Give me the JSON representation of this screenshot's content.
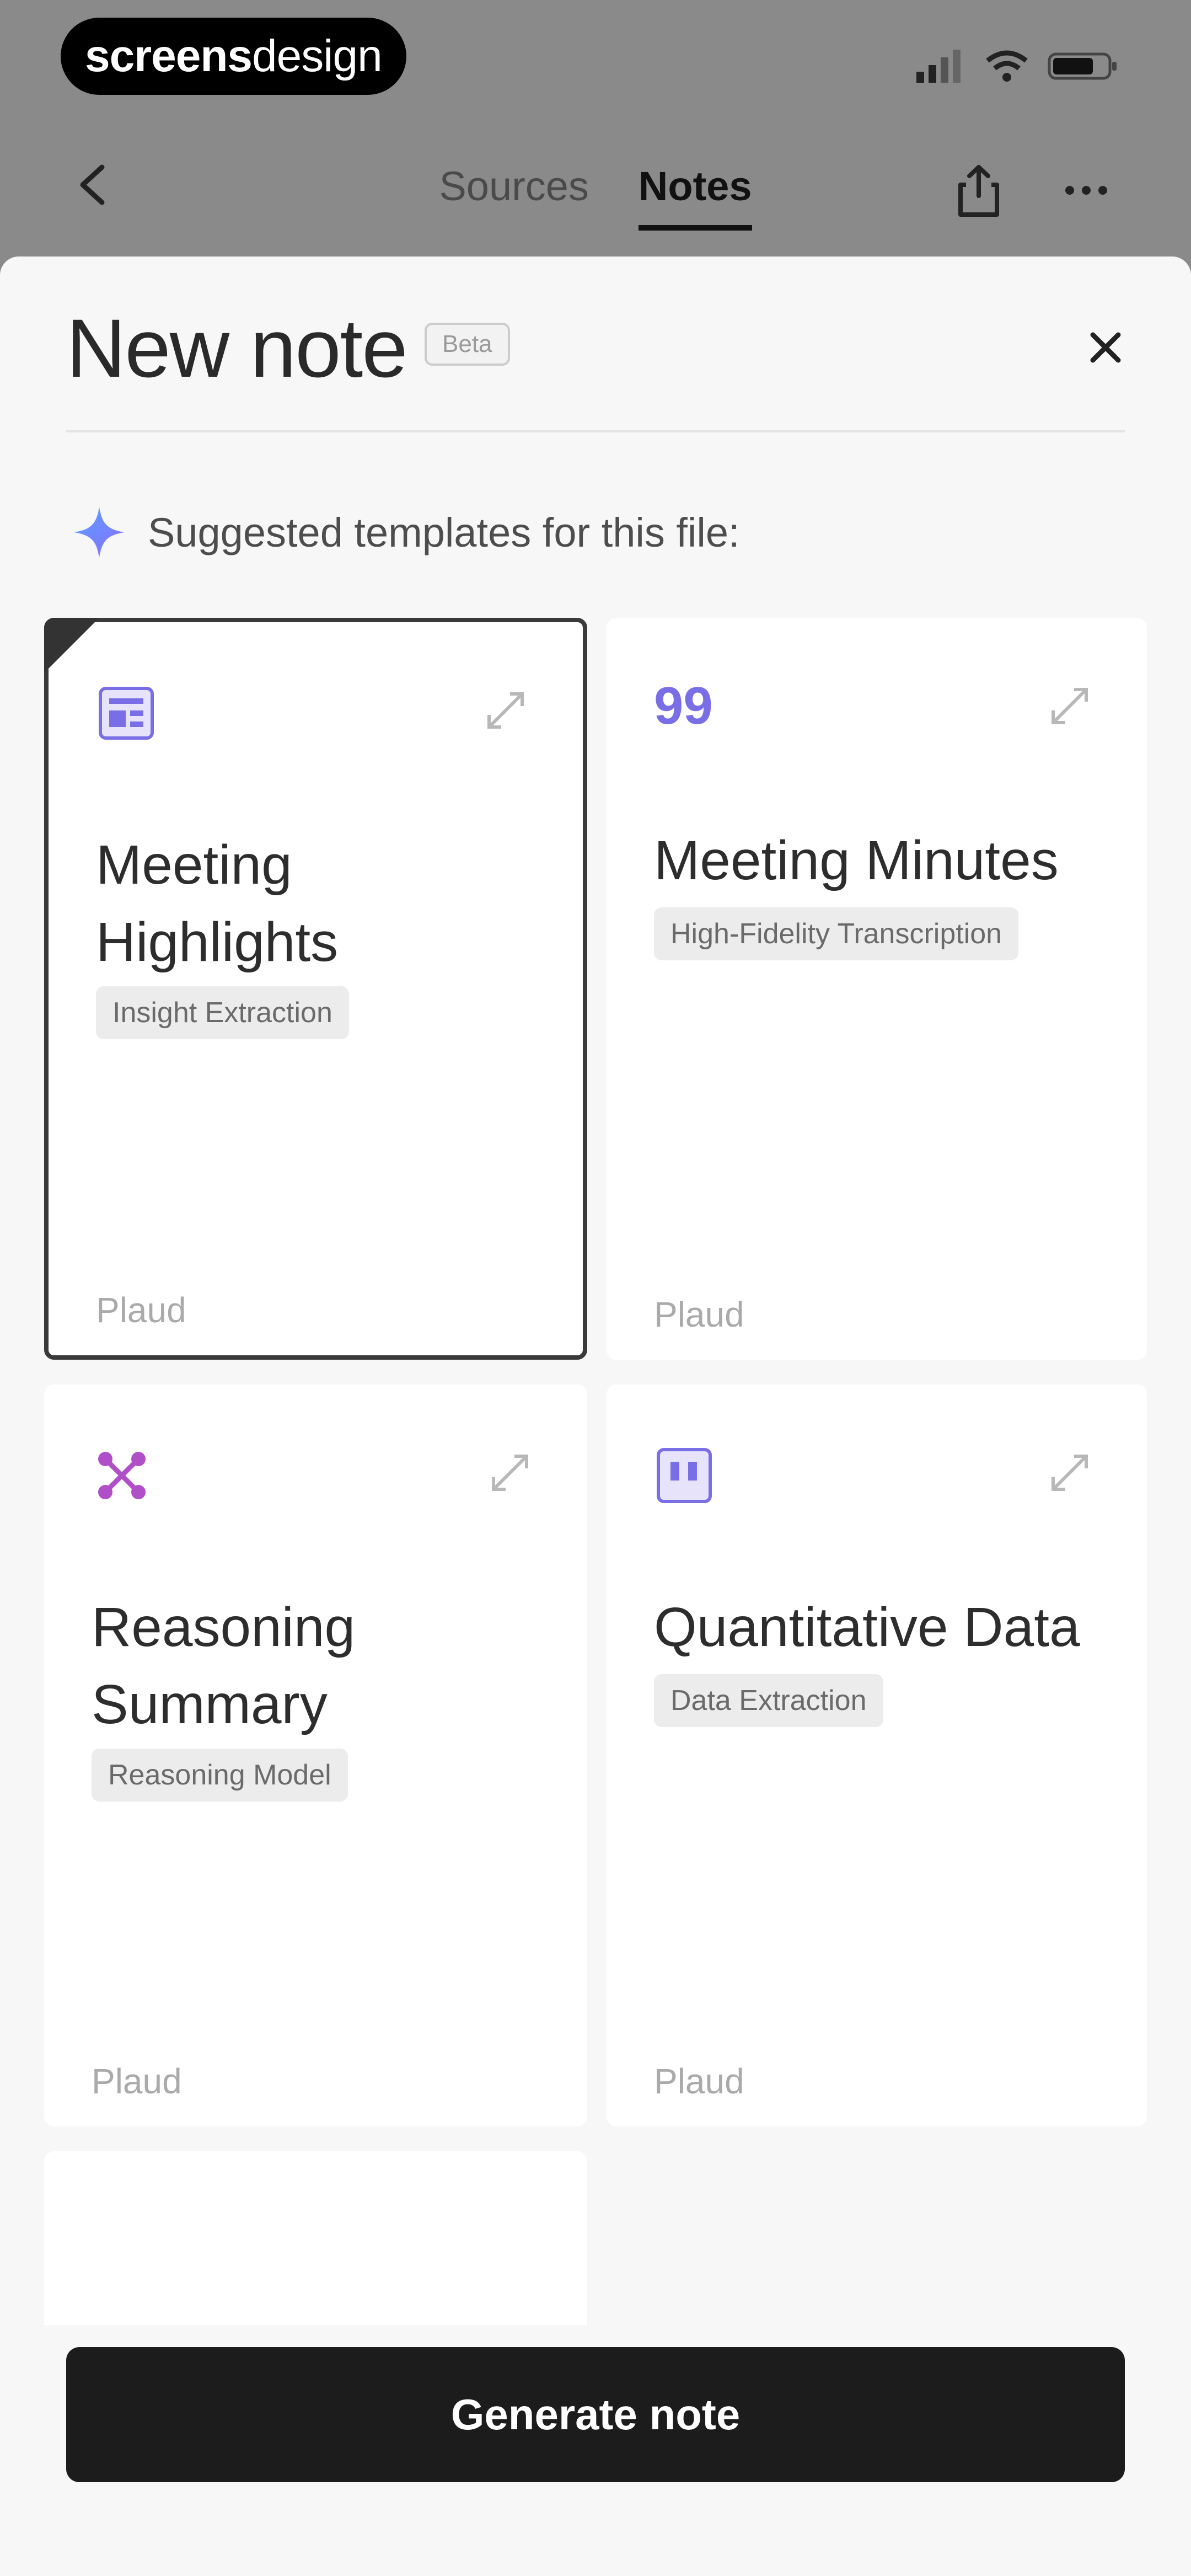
{
  "brand": {
    "part1": "screens",
    "part2": "design"
  },
  "status": {
    "icons": [
      "signal-icon",
      "wifi-icon",
      "battery-icon"
    ]
  },
  "nav": {
    "tabs": [
      {
        "label": "Sources",
        "active": false
      },
      {
        "label": "Notes",
        "active": true
      }
    ]
  },
  "sheet": {
    "title": "New note",
    "badge": "Beta",
    "suggest_label": "Suggested templates for this file:"
  },
  "templates": [
    {
      "title": "Meeting Highlights",
      "tag": "Insight Extraction",
      "source": "Plaud",
      "icon": "highlights-icon",
      "selected": true
    },
    {
      "title": "Meeting Minutes",
      "tag": "High-Fidelity Transcription",
      "source": "Plaud",
      "icon": "quote-icon",
      "selected": false
    },
    {
      "title": "Reasoning Summary",
      "tag": "Reasoning Model",
      "source": "Plaud",
      "icon": "reasoning-icon",
      "selected": false
    },
    {
      "title": "Quantitative Data",
      "tag": "Data Extraction",
      "source": "Plaud",
      "icon": "chart-icon",
      "selected": false
    }
  ],
  "actions": {
    "generate": "Generate note"
  },
  "colors": {
    "accent_icon": "#7a6ee6",
    "reasoning_icon": "#b04fc8",
    "primary_button": "#1c1c1c"
  }
}
